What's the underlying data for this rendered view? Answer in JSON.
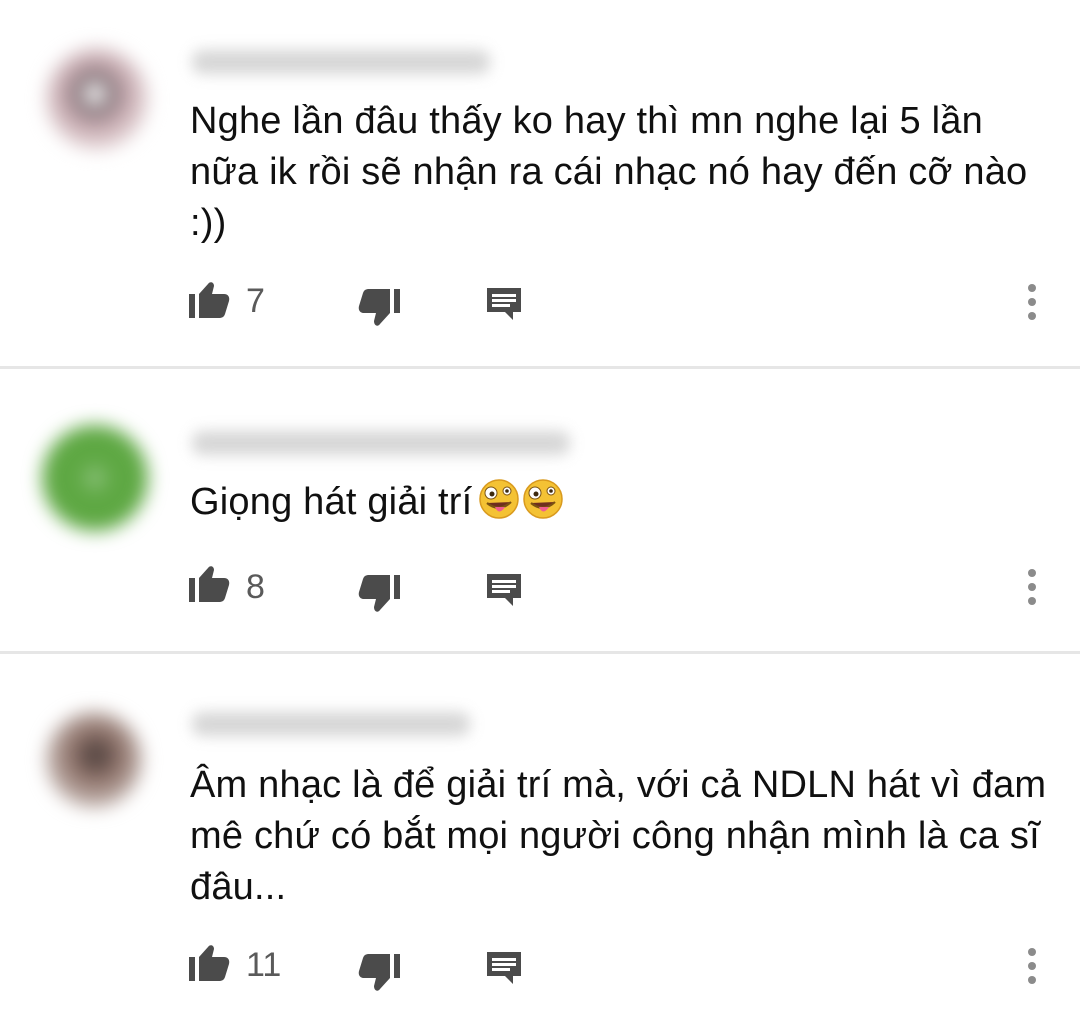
{
  "comments": [
    {
      "text": "Nghe lần đâu thấy ko hay thì mn nghe lại 5 lần nữa ik rồi sẽ nhận ra cái nhạc nó hay đến cỡ nào :))",
      "likes": "7",
      "avatar_color": "#b8a3a6"
    },
    {
      "text": "Giọng hát giải trí",
      "likes": "8",
      "avatar_color": "#5ea843",
      "emoji": [
        "zany-face-icon",
        "zany-face-icon"
      ]
    },
    {
      "text": "Âm nhạc là để giải trí mà, với cả NDLN hát vì đam mê chứ có bắt mọi người công nhận mình là ca sĩ đâu...",
      "likes": "11",
      "avatar_color": "#8c6f66"
    }
  ],
  "icons": {
    "like": "thumb-up-icon",
    "dislike": "thumb-down-icon",
    "reply": "reply-comment-icon",
    "more": "more-vertical-icon"
  }
}
